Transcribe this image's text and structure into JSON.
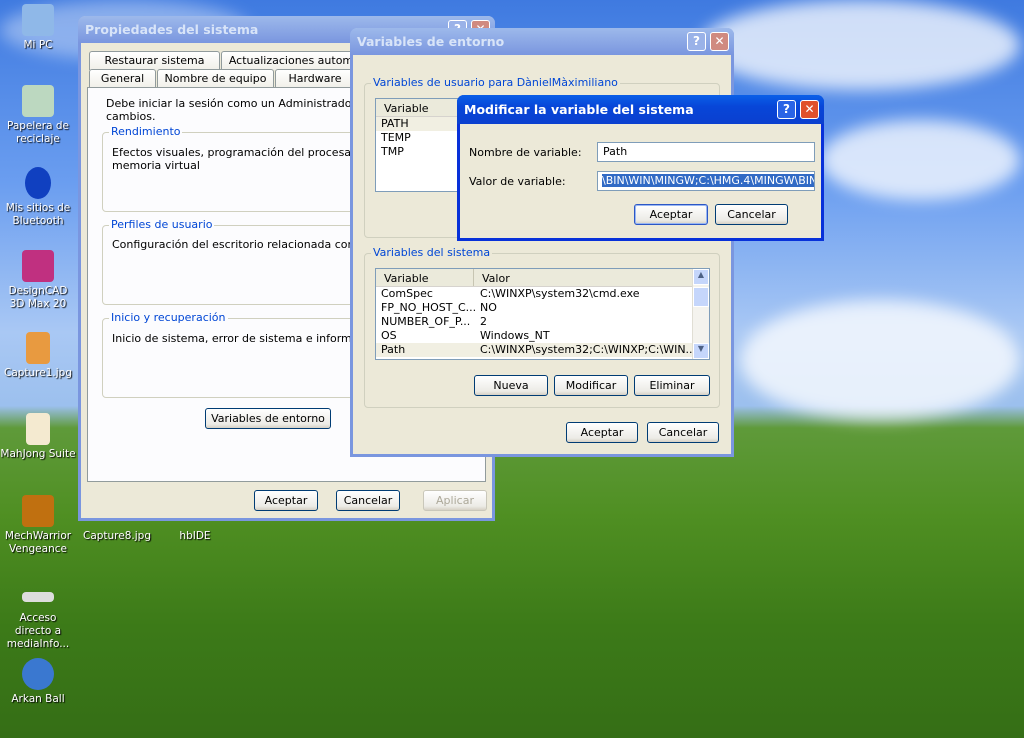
{
  "desktop": {
    "icons": [
      {
        "label": "Mi PC",
        "icon": "my-computer-icon"
      },
      {
        "label": "Papelera de reciclaje",
        "icon": "recycle-bin-icon"
      },
      {
        "label": "Mis sitios de Bluetooth",
        "icon": "bluetooth-icon"
      },
      {
        "label": "DesignCAD 3D Max 20",
        "icon": "designcad-icon"
      },
      {
        "label": "Capture1.jpg",
        "icon": "image-file-icon"
      },
      {
        "label": "MahJong Suite",
        "icon": "mahjong-icon"
      },
      {
        "label": "MechWarrior Vengeance",
        "icon": "mechwarrior-icon"
      },
      {
        "label": "Capture8.jpg",
        "icon": "image-file-icon"
      },
      {
        "label": "hbIDE",
        "icon": "hbide-icon"
      },
      {
        "label": "Acceso directo a mediaInfo...",
        "icon": "mediainfo-icon"
      },
      {
        "label": "Arkan Ball",
        "icon": "joystick-icon"
      }
    ]
  },
  "sysprops": {
    "title": "Propiedades del sistema",
    "tabs_row1": [
      "Restaurar sistema",
      "Actualizaciones autom"
    ],
    "tabs_row2": [
      "General",
      "Nombre de equipo",
      "Hardware"
    ],
    "notice": "Debe iniciar la sesión como un Administrador para ha",
    "notice2": "cambios.",
    "perf_title": "Rendimiento",
    "perf_text": "Efectos visuales, programación del procesador, uso",
    "perf_text2": "memoria virtual",
    "profiles_title": "Perfiles de usuario",
    "profiles_text": "Configuración del escritorio relacionada con su inic",
    "startup_title": "Inicio y recuperación",
    "startup_text": "Inicio de sistema, error de sistema e información de",
    "env_button": "Variables de entorno",
    "ok": "Aceptar",
    "cancel": "Cancelar",
    "apply": "Aplicar"
  },
  "envvars": {
    "title": "Variables de entorno",
    "user_group": "Variables de usuario para DànielMàximiliano",
    "user_header": "Variable",
    "user_vars": [
      "PATH",
      "TEMP",
      "TMP"
    ],
    "sys_group": "Variables del sistema",
    "sys_headers": [
      "Variable",
      "Valor"
    ],
    "sys_vars": [
      {
        "name": "ComSpec",
        "value": "C:\\WINXP\\system32\\cmd.exe"
      },
      {
        "name": "FP_NO_HOST_C...",
        "value": "NO"
      },
      {
        "name": "NUMBER_OF_P...",
        "value": "2"
      },
      {
        "name": "OS",
        "value": "Windows_NT"
      },
      {
        "name": "Path",
        "value": "C:\\WINXP\\system32;C:\\WINXP;C:\\WIN..."
      }
    ],
    "new": "Nueva",
    "edit": "Modificar",
    "delete": "Eliminar",
    "ok": "Aceptar",
    "cancel": "Cancelar"
  },
  "editvar": {
    "title": "Modificar la variable del sistema",
    "name_label": "Nombre de variable:",
    "name_value": "Path",
    "value_label": "Valor de variable:",
    "value_value": "\\BIN\\WIN\\MINGW;C:\\HMG.4\\MINGW\\BIN;",
    "ok": "Aceptar",
    "cancel": "Cancelar"
  },
  "colors": {
    "active_title": "#0a46d8",
    "selection": "#316ac5",
    "dialog_bg": "#ece9d8",
    "group_label": "#0046d5"
  }
}
